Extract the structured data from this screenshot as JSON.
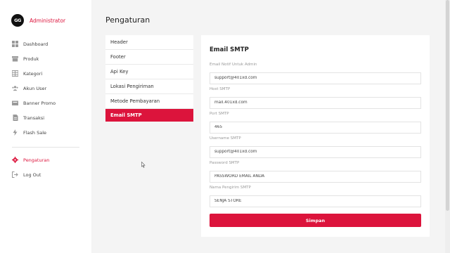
{
  "brand": {
    "logo_text": "GG",
    "name": "Administrator"
  },
  "sidebar": {
    "items": [
      {
        "label": "Dashboard",
        "icon": "dashboard-icon"
      },
      {
        "label": "Produk",
        "icon": "product-icon"
      },
      {
        "label": "Kategori",
        "icon": "category-icon"
      },
      {
        "label": "Akun User",
        "icon": "users-icon"
      },
      {
        "label": "Banner Promo",
        "icon": "banner-icon"
      },
      {
        "label": "Transaksi",
        "icon": "transaction-icon"
      },
      {
        "label": "Flash Sale",
        "icon": "flash-icon"
      }
    ],
    "bottom_items": [
      {
        "label": "Pengaturan",
        "icon": "gear-icon",
        "active": true
      },
      {
        "label": "Log Out",
        "icon": "logout-icon"
      }
    ]
  },
  "page": {
    "title": "Pengaturan"
  },
  "settings_menu": {
    "items": [
      "Header",
      "Footer",
      "Api Key",
      "Lokasi Pengiriman",
      "Metode Pembayaran",
      "Email SMTP"
    ],
    "active": "Email SMTP"
  },
  "form": {
    "title": "Email SMTP",
    "fields": [
      {
        "label": "Email Notif Untuk Admin",
        "value": "support@401xd.com"
      },
      {
        "label": "Host SMTP",
        "value": "mail.401xd.com"
      },
      {
        "label": "Port SMTP",
        "value": "465"
      },
      {
        "label": "Username SMTP",
        "value": "support@401xd.com"
      },
      {
        "label": "Password SMTP",
        "value": "PASSWORD EMAIL ANDA"
      },
      {
        "label": "Nama Pengirim SMTP",
        "value": "SENJA STORE"
      }
    ],
    "save_label": "Simpan"
  },
  "colors": {
    "accent": "#dc143c",
    "background": "#f4f4f4",
    "card": "#ffffff"
  }
}
